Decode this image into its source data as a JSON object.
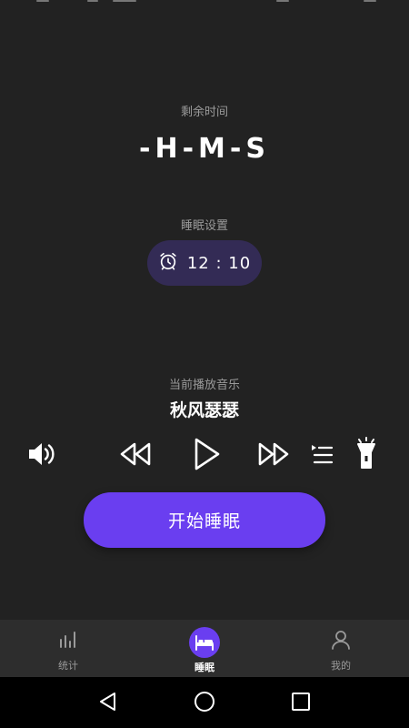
{
  "remaining": {
    "label": "剩余时间",
    "countdown": "-H-M-S"
  },
  "sleep_settings": {
    "label": "睡眠设置",
    "alarm_time": "12 : 10"
  },
  "now_playing": {
    "label": "当前播放音乐",
    "title": "秋风瑟瑟"
  },
  "controls": {
    "icons": [
      "volume-icon",
      "rewind-icon",
      "play-icon",
      "fast-forward-icon",
      "playlist-icon",
      "flashlight-icon"
    ]
  },
  "start_button": {
    "label": "开始睡眠"
  },
  "tabs": [
    {
      "label": "统计",
      "icon": "bar-chart-icon"
    },
    {
      "label": "睡眠",
      "icon": "bed-icon",
      "active": true
    },
    {
      "label": "我的",
      "icon": "person-icon"
    }
  ],
  "colors": {
    "background": "#222222",
    "accent": "#6a3ef0",
    "pill": "#332b55",
    "tab_bar": "#2d2d2d",
    "muted_text": "#9a9a9a"
  }
}
